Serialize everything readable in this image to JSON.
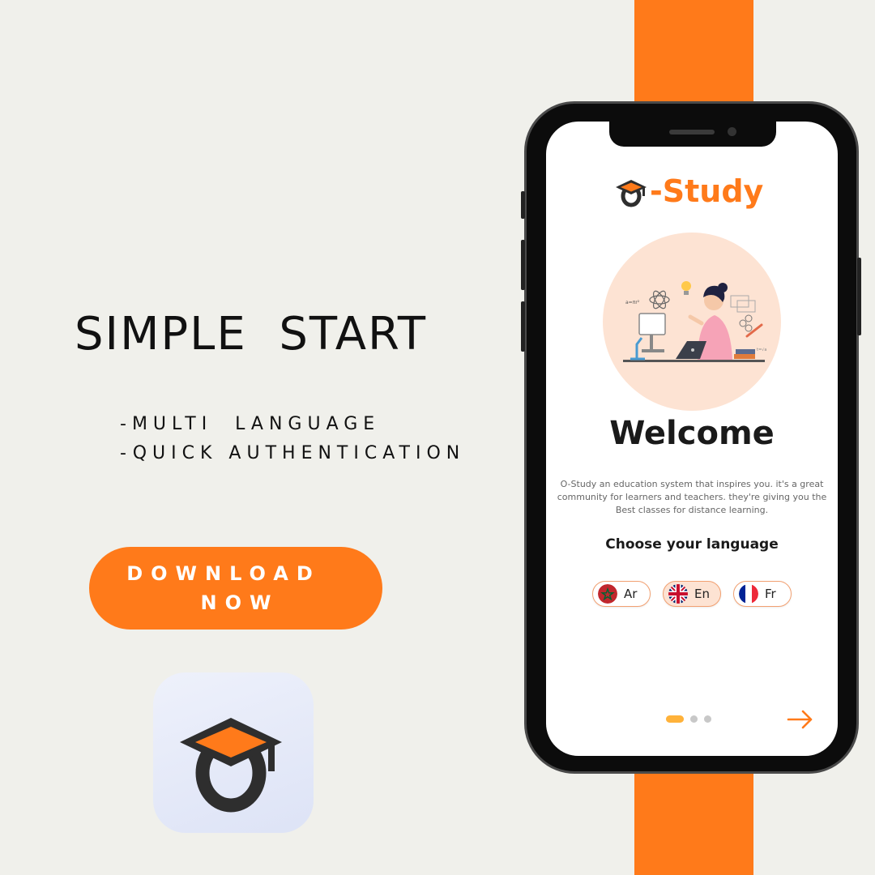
{
  "headline": "SIMPLE  START",
  "features": [
    "-MULTI  LANGUAGE",
    "-QUICK AUTHENTICATION"
  ],
  "cta": {
    "line1": "DOWNLOAD",
    "line2": "NOW"
  },
  "colors": {
    "accent": "#ff7a1a",
    "background": "#f0f0eb",
    "dark": "#2e2e2e"
  },
  "app_icon": {
    "icon": "graduation-cap-icon"
  },
  "phone": {
    "brand": {
      "suffix": "-Study",
      "icon": "graduation-cap-icon"
    },
    "illustration": "student-studying-illustration",
    "welcome": "Welcome",
    "description": "O-Study an education system that inspires you. it's a great community for learners and teachers. they're giving you the Best classes for distance learning.",
    "choose_language": "Choose your language",
    "languages": [
      {
        "label": "Ar",
        "flag": "morocco-flag-icon"
      },
      {
        "label": "En",
        "flag": "uk-flag-icon"
      },
      {
        "label": "Fr",
        "flag": "france-flag-icon"
      }
    ],
    "pagination": {
      "current": 1,
      "total": 3
    },
    "next": "arrow-right-icon"
  }
}
